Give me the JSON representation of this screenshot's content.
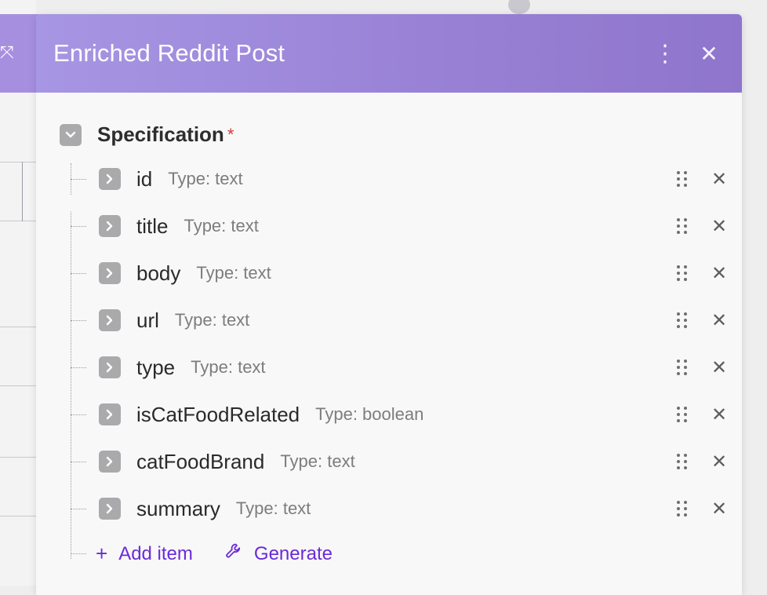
{
  "panel": {
    "title": "Enriched Reddit Post",
    "header_bg": "#9a85d8",
    "icons": {
      "more": "more-vertical-icon",
      "close": "close-icon"
    }
  },
  "spec": {
    "label": "Specification",
    "required_mark": "*",
    "expanded": true
  },
  "items": [
    {
      "name": "id",
      "type": "Type: text"
    },
    {
      "name": "title",
      "type": "Type: text"
    },
    {
      "name": "body",
      "type": "Type: text"
    },
    {
      "name": "url",
      "type": "Type: text"
    },
    {
      "name": "type",
      "type": "Type: text"
    },
    {
      "name": "isCatFoodRelated",
      "type": "Type: boolean"
    },
    {
      "name": "catFoodBrand",
      "type": "Type: text"
    },
    {
      "name": "summary",
      "type": "Type: text"
    }
  ],
  "actions": {
    "add_item": "Add item",
    "generate": "Generate",
    "accent": "#6a2bd9"
  }
}
